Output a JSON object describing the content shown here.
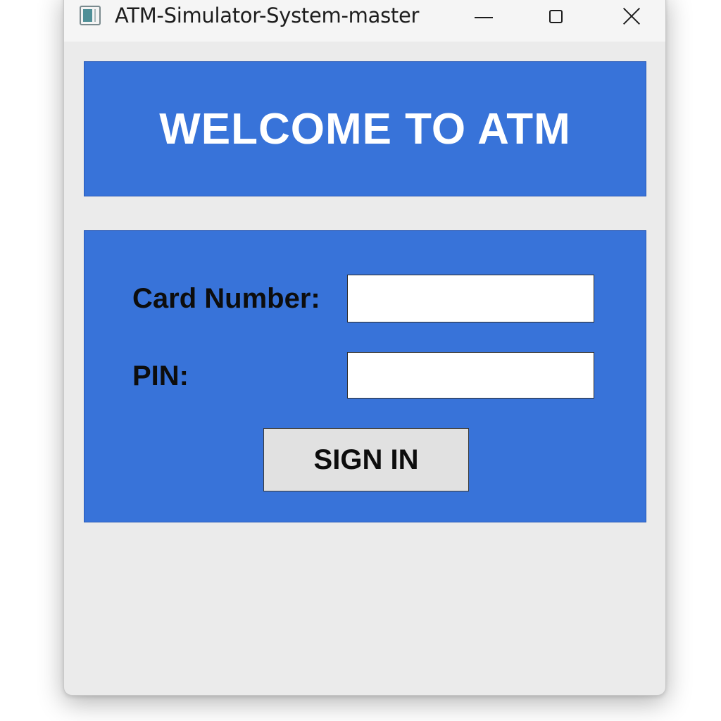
{
  "window": {
    "title": "ATM-Simulator-System-master",
    "icons": {
      "app": "app-window-icon",
      "minimize": "minimize-icon",
      "maximize": "maximize-icon",
      "close": "close-icon"
    }
  },
  "banner": {
    "title": "WELCOME TO ATM",
    "background": "#3873d9",
    "text_color": "#ffffff"
  },
  "login": {
    "card_number_label": "Card Number:",
    "card_number_value": "",
    "pin_label": "PIN:",
    "pin_value": "",
    "sign_in_label": "SIGN IN",
    "panel_color": "#3873d9"
  }
}
